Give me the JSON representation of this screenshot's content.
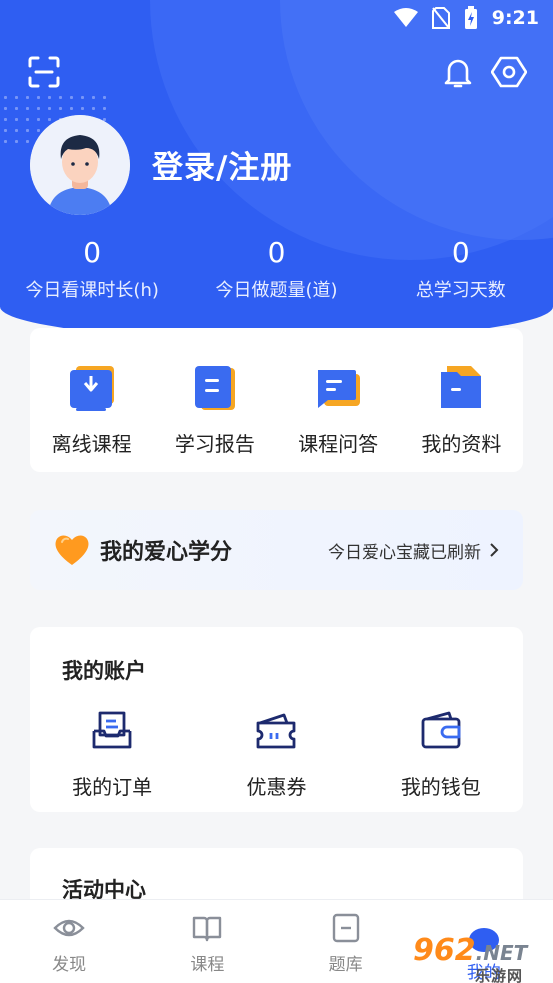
{
  "status_bar": {
    "time": "9:21"
  },
  "header": {
    "login_text": "登录/注册"
  },
  "stats": [
    {
      "value": "0",
      "label": "今日看课时长(h)"
    },
    {
      "value": "0",
      "label": "今日做题量(道)"
    },
    {
      "value": "0",
      "label": "总学习天数"
    }
  ],
  "quick_actions": [
    {
      "label": "离线课程",
      "icon": "download-icon"
    },
    {
      "label": "学习报告",
      "icon": "report-icon"
    },
    {
      "label": "课程问答",
      "icon": "chat-icon"
    },
    {
      "label": "我的资料",
      "icon": "folder-icon"
    }
  ],
  "love_credits": {
    "title": "我的爱心学分",
    "link_text": "今日爱心宝藏已刷新"
  },
  "account": {
    "title": "我的账户",
    "items": [
      {
        "label": "我的订单",
        "icon": "order-icon"
      },
      {
        "label": "优惠券",
        "icon": "coupon-icon"
      },
      {
        "label": "我的钱包",
        "icon": "wallet-icon"
      }
    ]
  },
  "activity": {
    "title": "活动中心"
  },
  "tabbar": [
    {
      "label": "发现",
      "icon": "eye-icon"
    },
    {
      "label": "课程",
      "icon": "book-icon"
    },
    {
      "label": "题库",
      "icon": "question-bank-icon"
    },
    {
      "label": "我的",
      "icon": "profile-icon"
    }
  ],
  "watermark": {
    "logo_num": "962",
    "logo_net": ".NET",
    "sub": "乐游网"
  },
  "colors": {
    "primary": "#2f5ef2",
    "heart": "#ff9a1f"
  }
}
